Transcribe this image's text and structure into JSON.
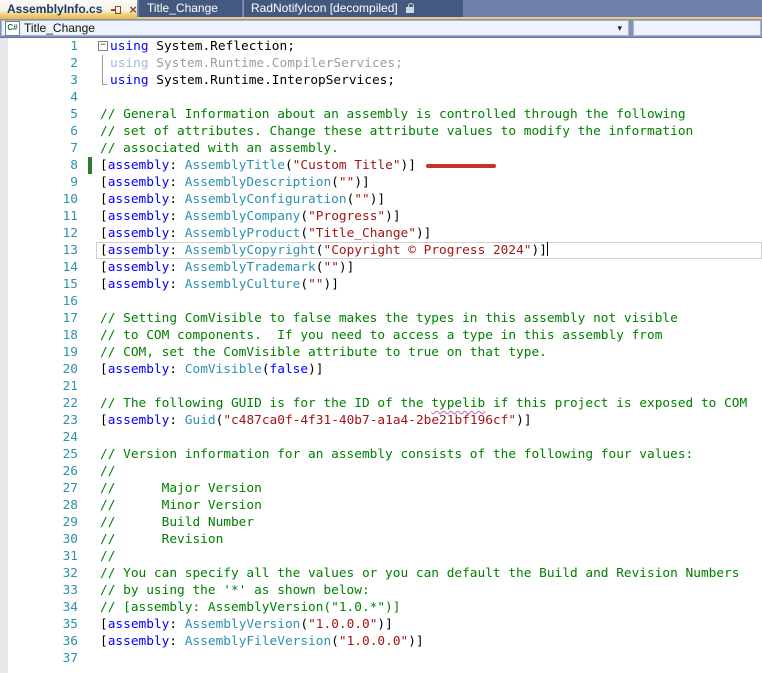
{
  "tabs": {
    "items": [
      {
        "label": "AssemblyInfo.cs",
        "active": true
      },
      {
        "label": "Title_Change",
        "active": false
      },
      {
        "label": "RadNotifyIcon [decompiled]",
        "active": false,
        "locked": true
      }
    ]
  },
  "navbar": {
    "project": "Title_Change",
    "member": ""
  },
  "icons": {
    "close": "×",
    "dropdown": "▾",
    "csharp": "C#",
    "fold_minus": "−",
    "pin": "pin-icon",
    "lock": "lock-icon"
  },
  "colors": {
    "keyword": "#0000ff",
    "type": "#2b91af",
    "string": "#a31515",
    "comment": "#008000",
    "line_number": "#2b91af",
    "change_bar": "#2d7d2d",
    "red_annotation": "#c5332b",
    "active_tab_accent": "#eab64a",
    "inactive_tab": "#44597f",
    "tab_strip": "#6d80a8"
  },
  "editor": {
    "lines": [
      {
        "n": 1,
        "ind": true,
        "fold": "minus",
        "segs": [
          {
            "c": "k",
            "t": "using"
          },
          {
            "c": "p",
            "t": " System.Reflection;"
          }
        ]
      },
      {
        "n": 2,
        "ind": true,
        "fold": "mid",
        "segs": [
          {
            "c": "gk",
            "t": "using"
          },
          {
            "c": "gp",
            "t": " System.Runtime.CompilerServices;"
          }
        ]
      },
      {
        "n": 3,
        "ind": true,
        "fold": "end",
        "segs": [
          {
            "c": "k",
            "t": "using"
          },
          {
            "c": "p",
            "t": " System.Runtime.InteropServices;"
          }
        ]
      },
      {
        "n": 4,
        "segs": []
      },
      {
        "n": 5,
        "segs": [
          {
            "c": "c",
            "t": "// General Information about an assembly is controlled through the following"
          }
        ]
      },
      {
        "n": 6,
        "segs": [
          {
            "c": "c",
            "t": "// set of attributes. Change these attribute values to modify the information"
          }
        ]
      },
      {
        "n": 7,
        "segs": [
          {
            "c": "c",
            "t": "// associated with an assembly."
          }
        ]
      },
      {
        "n": 8,
        "changeBar": true,
        "redMark": true,
        "segs": [
          {
            "c": "p",
            "t": "["
          },
          {
            "c": "k",
            "t": "assembly"
          },
          {
            "c": "p",
            "t": ": "
          },
          {
            "c": "t",
            "t": "AssemblyTitle"
          },
          {
            "c": "p",
            "t": "("
          },
          {
            "c": "s",
            "t": "\"Custom Title\""
          },
          {
            "c": "p",
            "t": ")]"
          }
        ]
      },
      {
        "n": 9,
        "segs": [
          {
            "c": "p",
            "t": "["
          },
          {
            "c": "k",
            "t": "assembly"
          },
          {
            "c": "p",
            "t": ": "
          },
          {
            "c": "t",
            "t": "AssemblyDescription"
          },
          {
            "c": "p",
            "t": "("
          },
          {
            "c": "s",
            "t": "\"\""
          },
          {
            "c": "p",
            "t": ")]"
          }
        ]
      },
      {
        "n": 10,
        "segs": [
          {
            "c": "p",
            "t": "["
          },
          {
            "c": "k",
            "t": "assembly"
          },
          {
            "c": "p",
            "t": ": "
          },
          {
            "c": "t",
            "t": "AssemblyConfiguration"
          },
          {
            "c": "p",
            "t": "("
          },
          {
            "c": "s",
            "t": "\"\""
          },
          {
            "c": "p",
            "t": ")]"
          }
        ]
      },
      {
        "n": 11,
        "segs": [
          {
            "c": "p",
            "t": "["
          },
          {
            "c": "k",
            "t": "assembly"
          },
          {
            "c": "p",
            "t": ": "
          },
          {
            "c": "t",
            "t": "AssemblyCompany"
          },
          {
            "c": "p",
            "t": "("
          },
          {
            "c": "s",
            "t": "\"Progress\""
          },
          {
            "c": "p",
            "t": ")]"
          }
        ]
      },
      {
        "n": 12,
        "segs": [
          {
            "c": "p",
            "t": "["
          },
          {
            "c": "k",
            "t": "assembly"
          },
          {
            "c": "p",
            "t": ": "
          },
          {
            "c": "t",
            "t": "AssemblyProduct"
          },
          {
            "c": "p",
            "t": "("
          },
          {
            "c": "s",
            "t": "\"Title_Change\""
          },
          {
            "c": "p",
            "t": ")]"
          }
        ]
      },
      {
        "n": 13,
        "current": true,
        "caret": true,
        "segs": [
          {
            "c": "p",
            "t": "["
          },
          {
            "c": "k",
            "t": "assembly"
          },
          {
            "c": "p",
            "t": ": "
          },
          {
            "c": "t",
            "t": "AssemblyCopyright"
          },
          {
            "c": "p",
            "t": "("
          },
          {
            "c": "s",
            "t": "\"Copyright © Progress 2024\""
          },
          {
            "c": "p",
            "t": ")]"
          }
        ]
      },
      {
        "n": 14,
        "segs": [
          {
            "c": "p",
            "t": "["
          },
          {
            "c": "k",
            "t": "assembly"
          },
          {
            "c": "p",
            "t": ": "
          },
          {
            "c": "t",
            "t": "AssemblyTrademark"
          },
          {
            "c": "p",
            "t": "("
          },
          {
            "c": "s",
            "t": "\"\""
          },
          {
            "c": "p",
            "t": ")]"
          }
        ]
      },
      {
        "n": 15,
        "segs": [
          {
            "c": "p",
            "t": "["
          },
          {
            "c": "k",
            "t": "assembly"
          },
          {
            "c": "p",
            "t": ": "
          },
          {
            "c": "t",
            "t": "AssemblyCulture"
          },
          {
            "c": "p",
            "t": "("
          },
          {
            "c": "s",
            "t": "\"\""
          },
          {
            "c": "p",
            "t": ")]"
          }
        ]
      },
      {
        "n": 16,
        "segs": []
      },
      {
        "n": 17,
        "segs": [
          {
            "c": "c",
            "t": "// Setting ComVisible to false makes the types in this assembly not visible"
          }
        ]
      },
      {
        "n": 18,
        "segs": [
          {
            "c": "c",
            "t": "// to COM components.  If you need to access a type in this assembly from"
          }
        ]
      },
      {
        "n": 19,
        "segs": [
          {
            "c": "c",
            "t": "// COM, set the ComVisible attribute to true on that type."
          }
        ]
      },
      {
        "n": 20,
        "segs": [
          {
            "c": "p",
            "t": "["
          },
          {
            "c": "k",
            "t": "assembly"
          },
          {
            "c": "p",
            "t": ": "
          },
          {
            "c": "t",
            "t": "ComVisible"
          },
          {
            "c": "p",
            "t": "("
          },
          {
            "c": "k",
            "t": "false"
          },
          {
            "c": "p",
            "t": ")]"
          }
        ]
      },
      {
        "n": 21,
        "segs": []
      },
      {
        "n": 22,
        "segs": [
          {
            "c": "c",
            "t": "// The following GUID is for the ID of the "
          },
          {
            "c": "cq",
            "t": "typelib"
          },
          {
            "c": "c",
            "t": " if this project is exposed to COM"
          }
        ]
      },
      {
        "n": 23,
        "segs": [
          {
            "c": "p",
            "t": "["
          },
          {
            "c": "k",
            "t": "assembly"
          },
          {
            "c": "p",
            "t": ": "
          },
          {
            "c": "t",
            "t": "Guid"
          },
          {
            "c": "p",
            "t": "("
          },
          {
            "c": "s",
            "t": "\"c487ca0f-4f31-40b7-a1a4-2be21bf196cf\""
          },
          {
            "c": "p",
            "t": ")]"
          }
        ]
      },
      {
        "n": 24,
        "segs": []
      },
      {
        "n": 25,
        "segs": [
          {
            "c": "c",
            "t": "// Version information for an assembly consists of the following four values:"
          }
        ]
      },
      {
        "n": 26,
        "segs": [
          {
            "c": "c",
            "t": "//"
          }
        ]
      },
      {
        "n": 27,
        "segs": [
          {
            "c": "c",
            "t": "//      Major Version"
          }
        ]
      },
      {
        "n": 28,
        "segs": [
          {
            "c": "c",
            "t": "//      Minor Version"
          }
        ]
      },
      {
        "n": 29,
        "segs": [
          {
            "c": "c",
            "t": "//      Build Number"
          }
        ]
      },
      {
        "n": 30,
        "segs": [
          {
            "c": "c",
            "t": "//      Revision"
          }
        ]
      },
      {
        "n": 31,
        "segs": [
          {
            "c": "c",
            "t": "//"
          }
        ]
      },
      {
        "n": 32,
        "segs": [
          {
            "c": "c",
            "t": "// You can specify all the values or you can default the Build and Revision Numbers"
          }
        ]
      },
      {
        "n": 33,
        "segs": [
          {
            "c": "c",
            "t": "// by using the '*' as shown below:"
          }
        ]
      },
      {
        "n": 34,
        "segs": [
          {
            "c": "c",
            "t": "// [assembly: AssemblyVersion(\"1.0.*\")]"
          }
        ]
      },
      {
        "n": 35,
        "segs": [
          {
            "c": "p",
            "t": "["
          },
          {
            "c": "k",
            "t": "assembly"
          },
          {
            "c": "p",
            "t": ": "
          },
          {
            "c": "t",
            "t": "AssemblyVersion"
          },
          {
            "c": "p",
            "t": "("
          },
          {
            "c": "s",
            "t": "\"1.0.0.0\""
          },
          {
            "c": "p",
            "t": ")]"
          }
        ]
      },
      {
        "n": 36,
        "segs": [
          {
            "c": "p",
            "t": "["
          },
          {
            "c": "k",
            "t": "assembly"
          },
          {
            "c": "p",
            "t": ": "
          },
          {
            "c": "t",
            "t": "AssemblyFileVersion"
          },
          {
            "c": "p",
            "t": "("
          },
          {
            "c": "s",
            "t": "\"1.0.0.0\""
          },
          {
            "c": "p",
            "t": ")]"
          }
        ]
      },
      {
        "n": 37,
        "segs": []
      }
    ]
  }
}
